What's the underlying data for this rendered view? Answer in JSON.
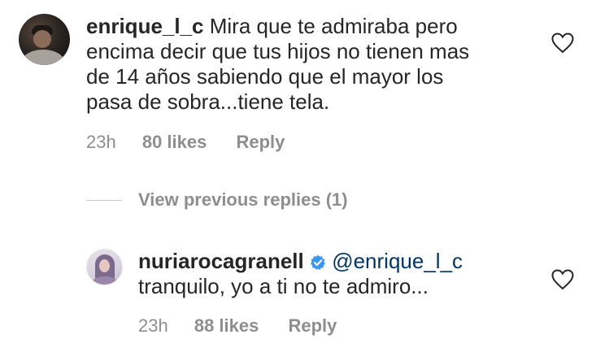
{
  "comment": {
    "username": "enrique_l_c",
    "text_line1": "Mira que te admiraba pero",
    "text_line2": "encima decir que tus hijos no tienen mas",
    "text_line3": "de 14 años sabiendo que el mayor los",
    "text_line4": "pasa de sobra...tiene tela.",
    "time": "23h",
    "likes": "80 likes",
    "reply_label": "Reply"
  },
  "view_previous": {
    "label": "View previous replies (1)"
  },
  "reply": {
    "username": "nuriarocagranell",
    "mention": "@enrique_l_c",
    "text": "tranquilo, yo a ti no te admiro...",
    "time": "23h",
    "likes": "88 likes",
    "reply_label": "Reply"
  },
  "icons": {
    "like": "heart-outline-icon",
    "verified": "verified-badge-icon"
  },
  "colors": {
    "verified": "#3897f0",
    "mention": "#003569",
    "muted": "#8e8e8e"
  }
}
